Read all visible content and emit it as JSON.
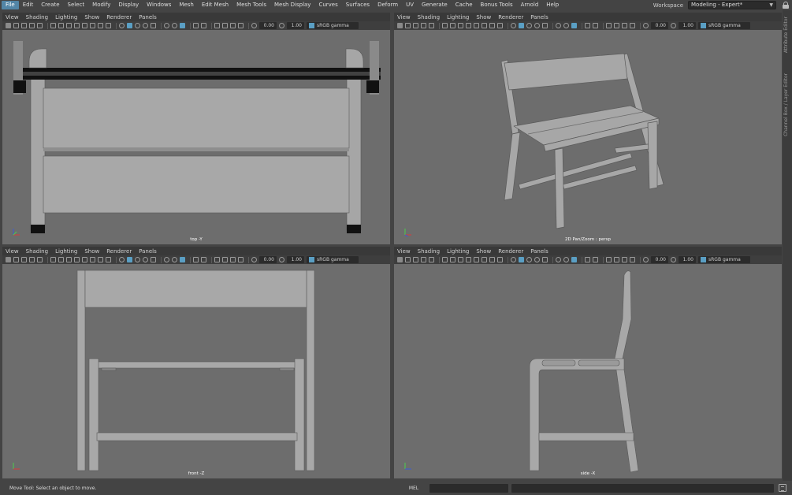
{
  "menubar": {
    "items": [
      "File",
      "Edit",
      "Create",
      "Select",
      "Modify",
      "Display",
      "Windows",
      "Mesh",
      "Edit Mesh",
      "Mesh Tools",
      "Mesh Display",
      "Curves",
      "Surfaces",
      "Deform",
      "UV",
      "Generate",
      "Cache",
      "Bonus Tools",
      "Arnold",
      "Help"
    ],
    "active_index": 0,
    "workspace_label": "Workspace",
    "workspace_value": "Modeling - Expert*"
  },
  "side_tabs": {
    "attribute_editor": "Attribute Editor",
    "channel_box": "Channel Box / Layer Editor"
  },
  "panel_menu": [
    "View",
    "Shading",
    "Lighting",
    "Show",
    "Renderer",
    "Panels"
  ],
  "toolbar": {
    "exposure": "0.00",
    "gamma": "1.00",
    "color_management": "sRGB gamma"
  },
  "viewports": {
    "top": {
      "label": "top -Y"
    },
    "persp": {
      "label": "2D Pan/Zoom : persp"
    },
    "front": {
      "label": "front -Z"
    },
    "side": {
      "label": "side -X"
    }
  },
  "statusbar": {
    "help_text": "Move Tool: Select an object to move.",
    "script_language": "MEL"
  },
  "colors": {
    "accent": "#5285a6",
    "viewport_bg": "#6d6d6d",
    "mesh": "#a6a6a6",
    "ui_bg": "#444444"
  }
}
